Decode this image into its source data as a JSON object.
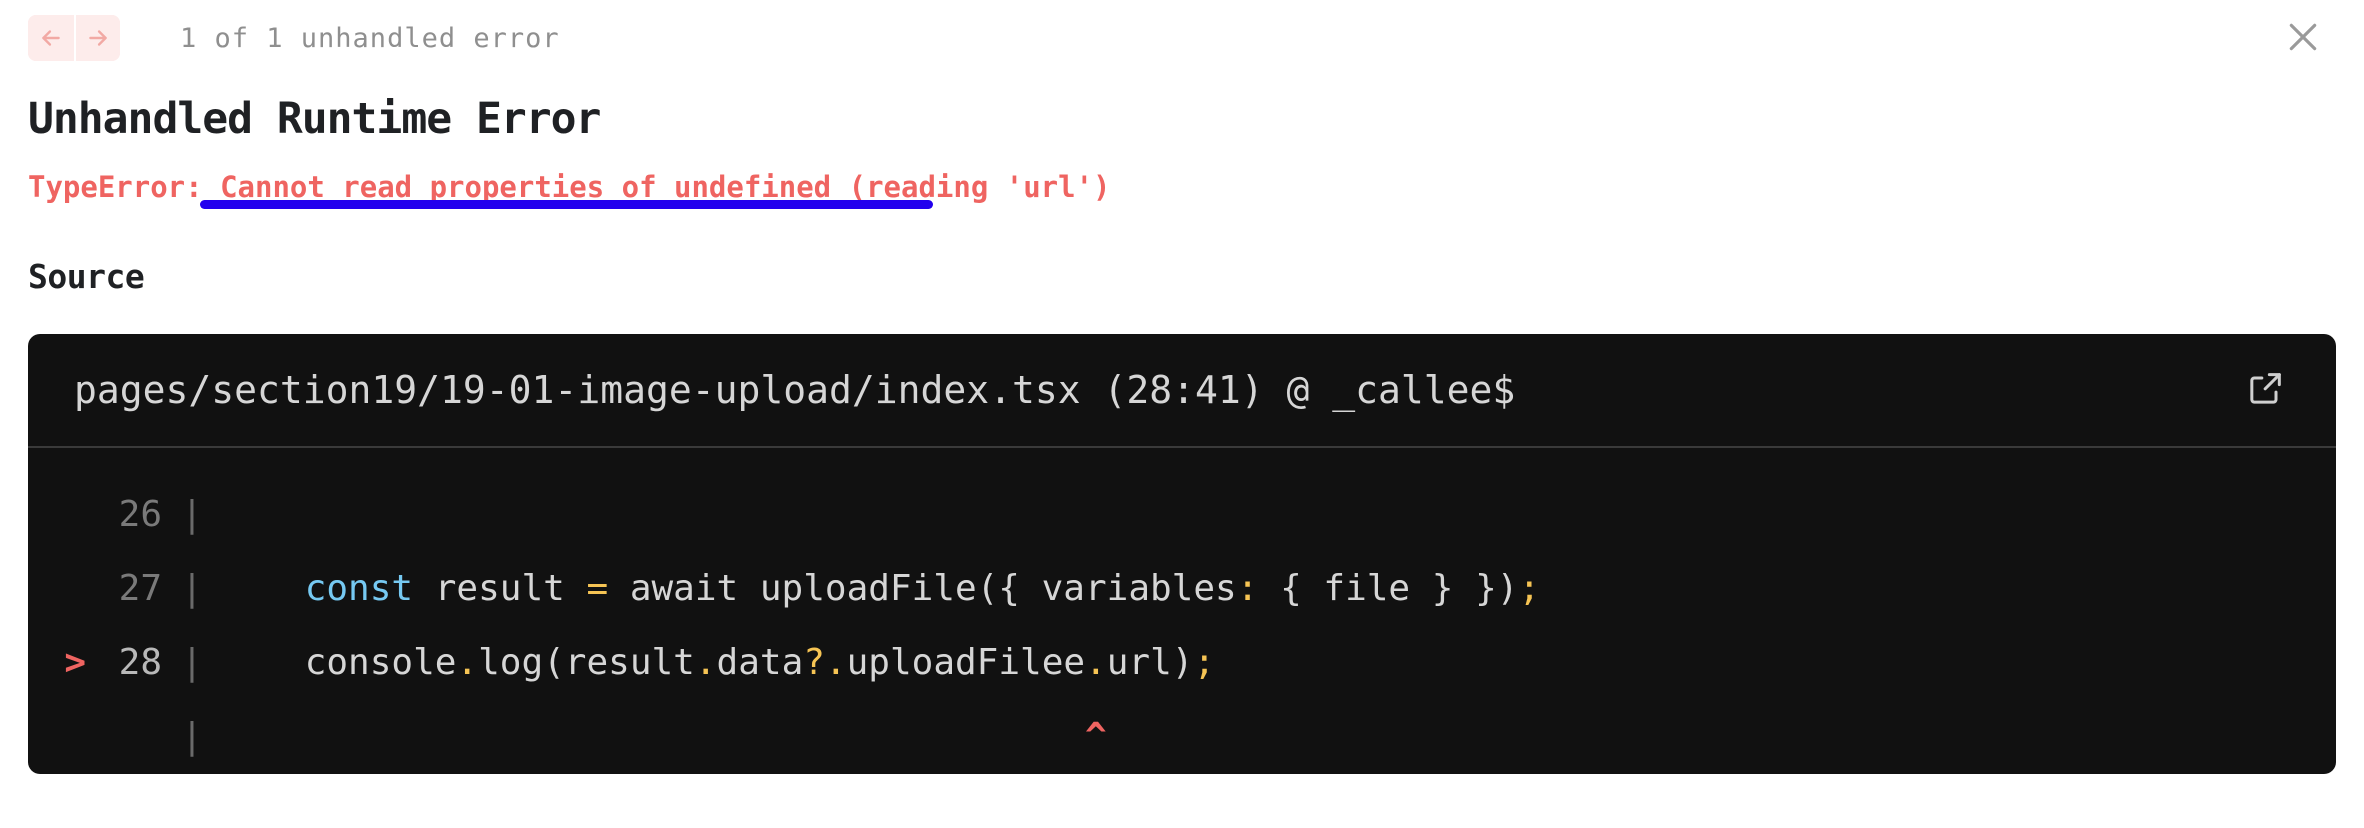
{
  "toolbar": {
    "prev_label": "Previous error",
    "next_label": "Next error",
    "error_count": "1 of 1 unhandled error",
    "close_label": "Close"
  },
  "error": {
    "heading": "Unhandled Runtime Error",
    "type": "TypeError: ",
    "description": "Cannot read properties of undefined (reading 'url')",
    "underline_color": "#2200ee",
    "accent_color": "#ef6461"
  },
  "source": {
    "label": "Source",
    "path": "pages/section19/19-01-image-upload/index.tsx (28:41) @ _callee$",
    "open_in_editor_label": "Open in editor",
    "lines": [
      {
        "marker": "",
        "number": "26",
        "pipe": "|",
        "current": false,
        "tokens": [
          {
            "text": "",
            "kind": "def"
          }
        ]
      },
      {
        "marker": "",
        "number": "27",
        "pipe": "|",
        "current": false,
        "tokens": [
          {
            "text": "    ",
            "kind": "def"
          },
          {
            "text": "const",
            "kind": "kw"
          },
          {
            "text": " result ",
            "kind": "def"
          },
          {
            "text": "=",
            "kind": "pun"
          },
          {
            "text": " await uploadFile({ variables",
            "kind": "def"
          },
          {
            "text": ":",
            "kind": "pun"
          },
          {
            "text": " { file } })",
            "kind": "def"
          },
          {
            "text": ";",
            "kind": "pun"
          }
        ]
      },
      {
        "marker": ">",
        "number": "28",
        "pipe": "|",
        "current": true,
        "tokens": [
          {
            "text": "    console",
            "kind": "def"
          },
          {
            "text": ".",
            "kind": "pun"
          },
          {
            "text": "log(result",
            "kind": "def"
          },
          {
            "text": ".",
            "kind": "pun"
          },
          {
            "text": "data",
            "kind": "def"
          },
          {
            "text": "?",
            "kind": "pun"
          },
          {
            "text": ".",
            "kind": "pun"
          },
          {
            "text": "uploadFilee",
            "kind": "def"
          },
          {
            "text": ".",
            "kind": "pun"
          },
          {
            "text": "url)",
            "kind": "def"
          },
          {
            "text": ";",
            "kind": "pun"
          }
        ]
      },
      {
        "marker": "",
        "number": "",
        "pipe": "|",
        "current": false,
        "caret": "                                        ^",
        "tokens": []
      }
    ]
  }
}
